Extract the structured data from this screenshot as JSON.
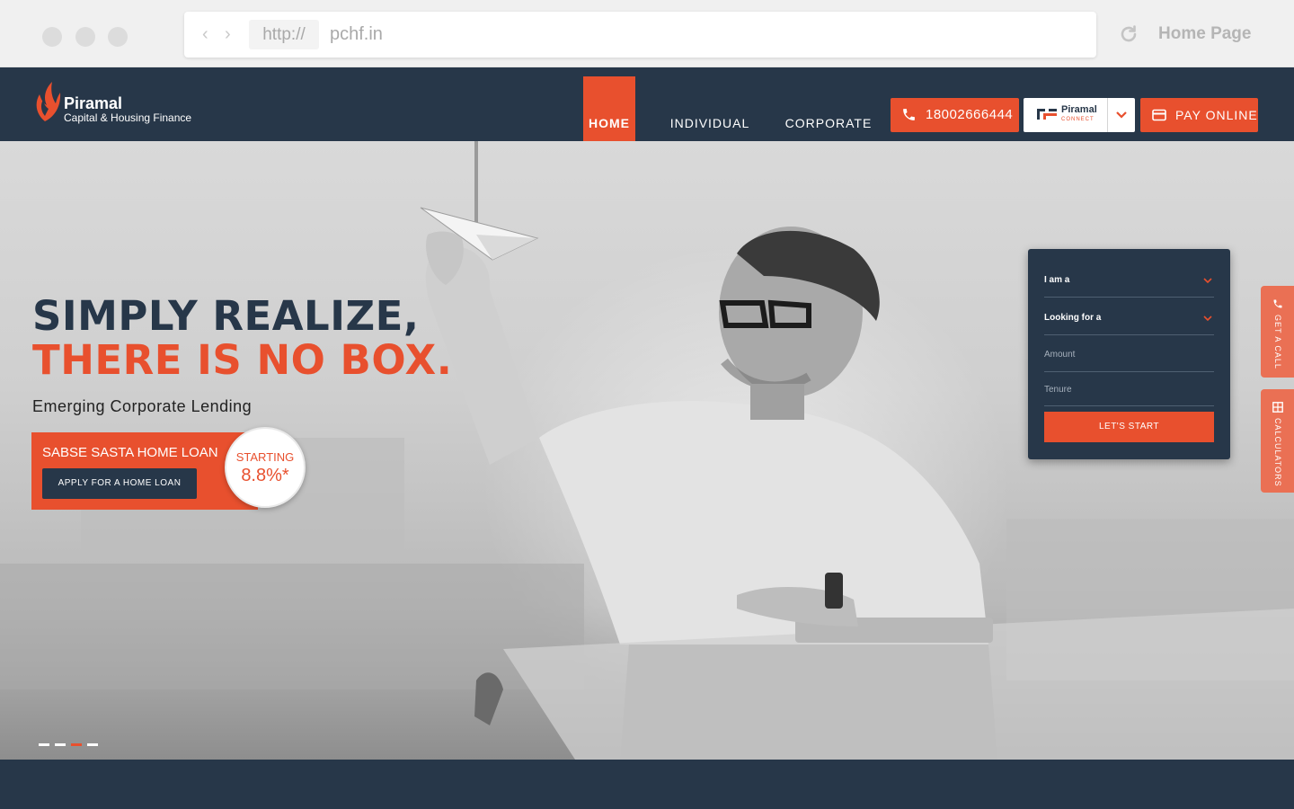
{
  "browser": {
    "protocol": "http://",
    "url": "pchf.in",
    "tab_title": "Home Page"
  },
  "header": {
    "logo_name": "Piramal",
    "logo_tagline": "Capital & Housing Finance",
    "nav": [
      {
        "label": "HOME",
        "active": true
      },
      {
        "label": "INDIVIDUAL",
        "active": false
      },
      {
        "label": "CORPORATE",
        "active": false
      }
    ],
    "phone_number": "18002666444",
    "connect_brand": "Piramal",
    "connect_sub": "CONNECT",
    "pay_label": "PAY ONLINE"
  },
  "hero": {
    "headline_line1": "SIMPLY REALIZE,",
    "headline_line2": "THERE IS NO BOX.",
    "subheading": "Emerging Corporate Lending",
    "promo_title": "SABSE SASTA HOME LOAN",
    "promo_button": "APPLY FOR A HOME LOAN",
    "badge_top": "STARTING",
    "badge_rate": "8.8%*",
    "slides": {
      "count": 4,
      "active_index": 2
    }
  },
  "form": {
    "i_am_a": "I am a",
    "looking_for": "Looking for a",
    "amount_placeholder": "Amount",
    "tenure_placeholder": "Tenure",
    "submit_label": "LET'S START"
  },
  "side_tabs": {
    "get_call": "GET A CALL",
    "calculators": "CALCULATORS"
  },
  "colors": {
    "brand_navy": "#273749",
    "brand_orange": "#e8502e",
    "side_tab": "#ea7054"
  }
}
